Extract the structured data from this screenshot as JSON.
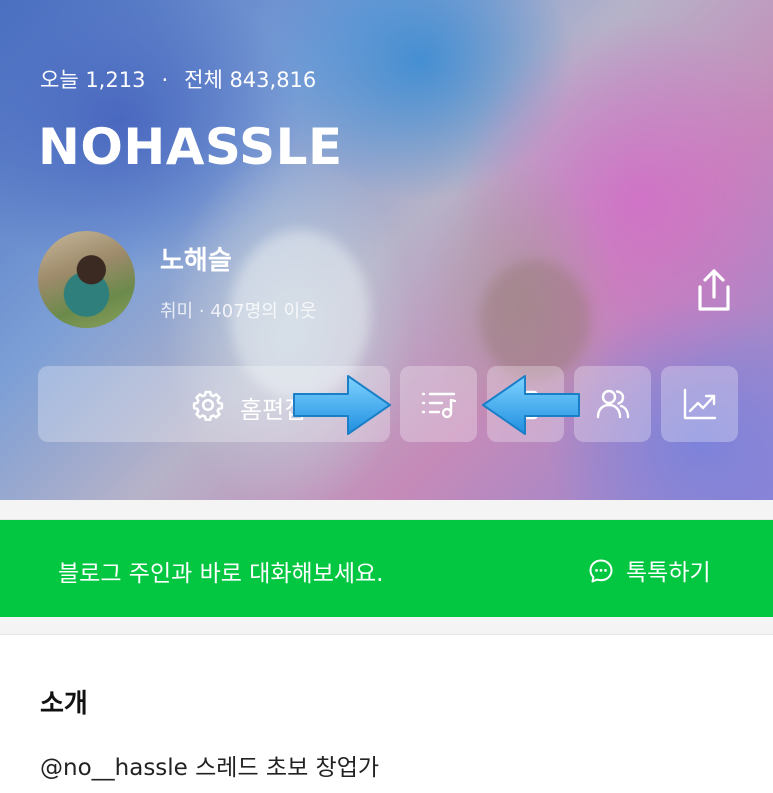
{
  "header": {
    "stats_today": "오늘 1,213",
    "stats_sep": "·",
    "stats_total": "전체 843,816",
    "blog_title": "NOHASSLE"
  },
  "profile": {
    "name": "노해슬",
    "meta": "취미 · 407명의 이웃"
  },
  "actions": {
    "home_edit_label": "홈편집",
    "icons": [
      "gear-icon",
      "playlist-icon",
      "post-icon",
      "neighbors-icon",
      "stats-chart-icon",
      "share-icon"
    ]
  },
  "talk_banner": {
    "message": "블로그 주인과 바로 대화해보세요.",
    "action_label": "톡톡하기",
    "color": "#03c740"
  },
  "intro": {
    "heading": "소개",
    "text": "@no__hassle 스레드 초보 창업가"
  },
  "annotations": {
    "arrow_color": "#3aaef5"
  }
}
